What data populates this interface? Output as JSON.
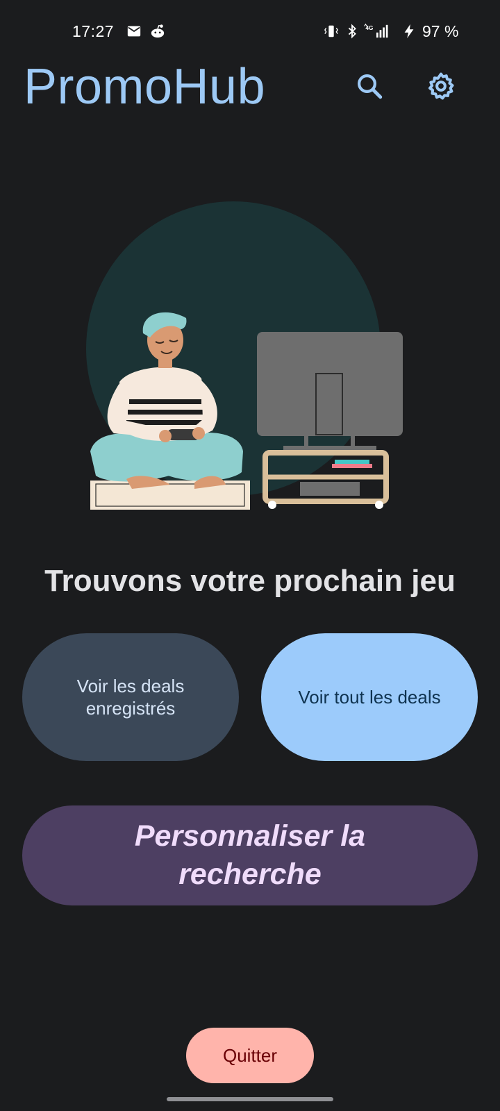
{
  "status_bar": {
    "time": "17:27",
    "battery": "97 %",
    "icons": [
      "mail-icon",
      "reddit-icon",
      "vibrate-icon",
      "bluetooth-icon",
      "signal-4g-icon",
      "charging-icon"
    ]
  },
  "app_bar": {
    "title": "PromoHub",
    "actions": [
      "search-icon",
      "settings-icon"
    ]
  },
  "illustration": {
    "subject": "person-playing-video-games-illustration"
  },
  "main": {
    "headline": "Trouvons votre prochain jeu",
    "saved_deals_label": "Voir les deals enregistrés",
    "all_deals_label": "Voir tout les deals",
    "customize_label": "Personnaliser la recherche",
    "quit_label": "Quitter"
  },
  "colors": {
    "background": "#1b1c1e",
    "accent": "#9dc9f5",
    "saved_button": "#3b4858",
    "all_button": "#9ccbfb",
    "custom_button": "#4d3f62",
    "quit_button": "#ffb4ab"
  }
}
